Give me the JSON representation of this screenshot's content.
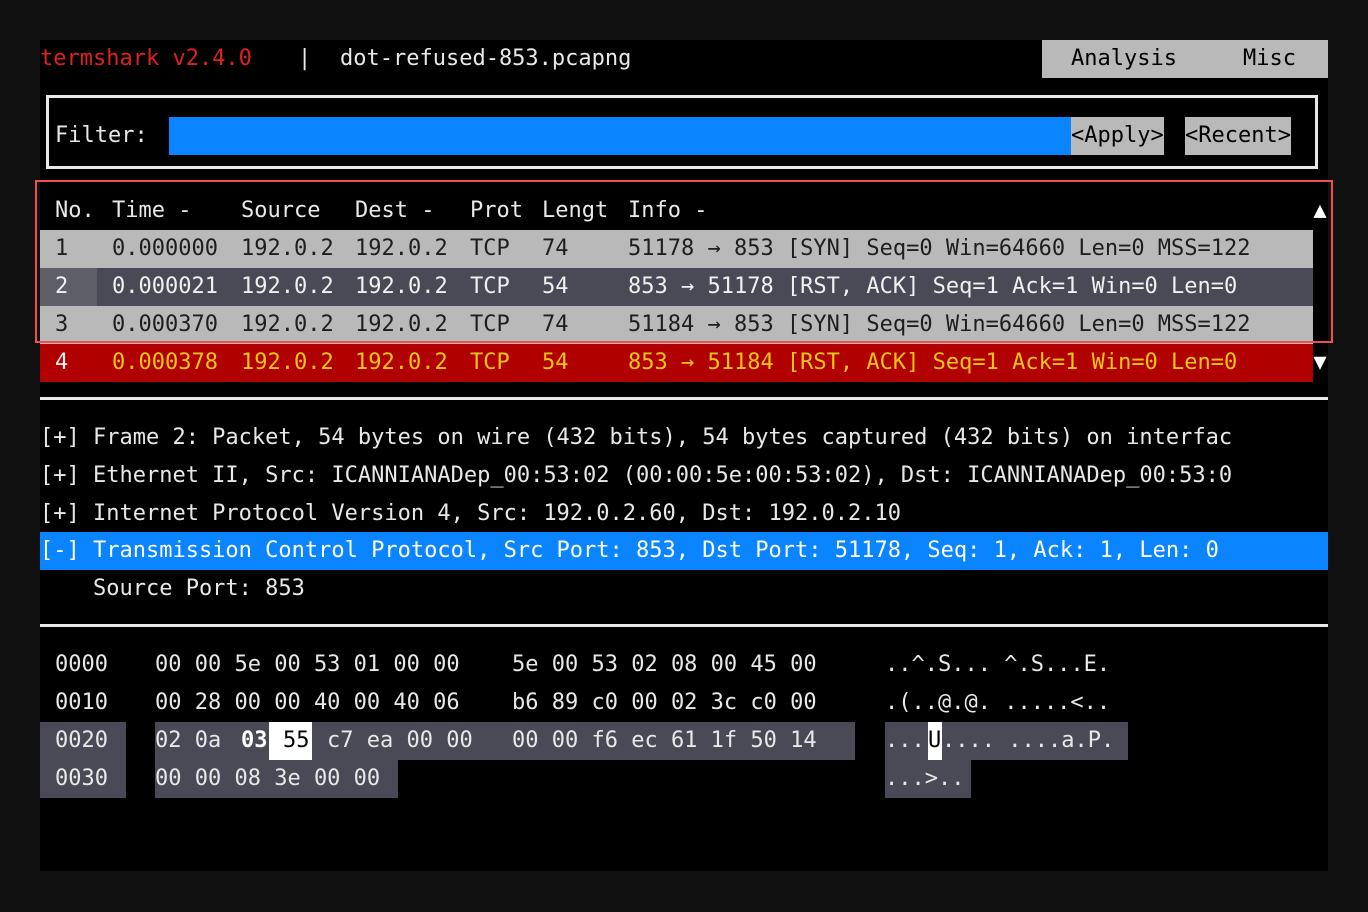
{
  "title": {
    "app": "termshark v2.4.0",
    "separator": "|",
    "file": "dot-refused-853.pcapng"
  },
  "menu": {
    "analysis": "Analysis",
    "misc": "Misc"
  },
  "filter": {
    "label": "Filter:",
    "value": "",
    "apply": "<Apply>",
    "recent": "<Recent>"
  },
  "packet_list": {
    "headers": {
      "no": "No.",
      "time": "Time -",
      "source": "Source",
      "dest": "Dest -",
      "prot": "Prot",
      "length": "Lengt",
      "info": "Info -"
    },
    "rows": [
      {
        "no": "1",
        "time": "0.000000",
        "source": "192.0.2",
        "dest": "192.0.2",
        "prot": "TCP",
        "length": "74",
        "info": "51178 → 853 [SYN] Seq=0 Win=64660 Len=0 MSS=122"
      },
      {
        "no": "2",
        "time": "0.000021",
        "source": "192.0.2",
        "dest": "192.0.2",
        "prot": "TCP",
        "length": "54",
        "info": "853 → 51178 [RST, ACK] Seq=1 Ack=1 Win=0 Len=0"
      },
      {
        "no": "3",
        "time": "0.000370",
        "source": "192.0.2",
        "dest": "192.0.2",
        "prot": "TCP",
        "length": "74",
        "info": "51184 → 853 [SYN] Seq=0 Win=64660 Len=0 MSS=122"
      },
      {
        "no": "4",
        "time": "0.000378",
        "source": "192.0.2",
        "dest": "192.0.2",
        "prot": "TCP",
        "length": "54",
        "info": "853 → 51184 [RST, ACK] Seq=1 Ack=1 Win=0 Len=0"
      }
    ],
    "scroll_up": "▲",
    "scroll_down": "▼"
  },
  "details": {
    "lines": [
      "[+] Frame 2: Packet, 54 bytes on wire (432 bits), 54 bytes captured (432 bits) on interfac",
      "[+] Ethernet II, Src: ICANNIANADep_00:53:02 (00:00:5e:00:53:02), Dst: ICANNIANADep_00:53:0",
      "[+] Internet Protocol Version 4, Src: 192.0.2.60, Dst: 192.0.2.10",
      "[-] Transmission Control Protocol, Src Port: 853, Dst Port: 51178, Seq: 1, Ack: 1, Len: 0",
      "    Source Port: 853"
    ]
  },
  "hex": {
    "rows": [
      {
        "offset": "0000",
        "g1": "00 00 5e 00 53 01 00 00",
        "g2": "5e 00 53 02 08 00 45 00",
        "ascii": "..^.S... ^.S...E."
      },
      {
        "offset": "0010",
        "g1": "00 28 00 00 40 00 40 06",
        "g2": "b6 89 c0 00 02 3c c0 00",
        "ascii": ".(..@.@. .....<.."
      },
      {
        "offset": "0020",
        "g1a": "02 0a",
        "g1b": "03",
        "g1c": "55",
        "g1d": "c7 ea 00 00",
        "g2": "00 00 f6 ec 61 1f 50 14",
        "ascii_a": "...",
        "ascii_b": "U",
        "ascii_c": ".... ....a.P."
      },
      {
        "offset": "0030",
        "g1": "00 00 08 3e 00 00",
        "ascii": "...>.."
      }
    ]
  }
}
